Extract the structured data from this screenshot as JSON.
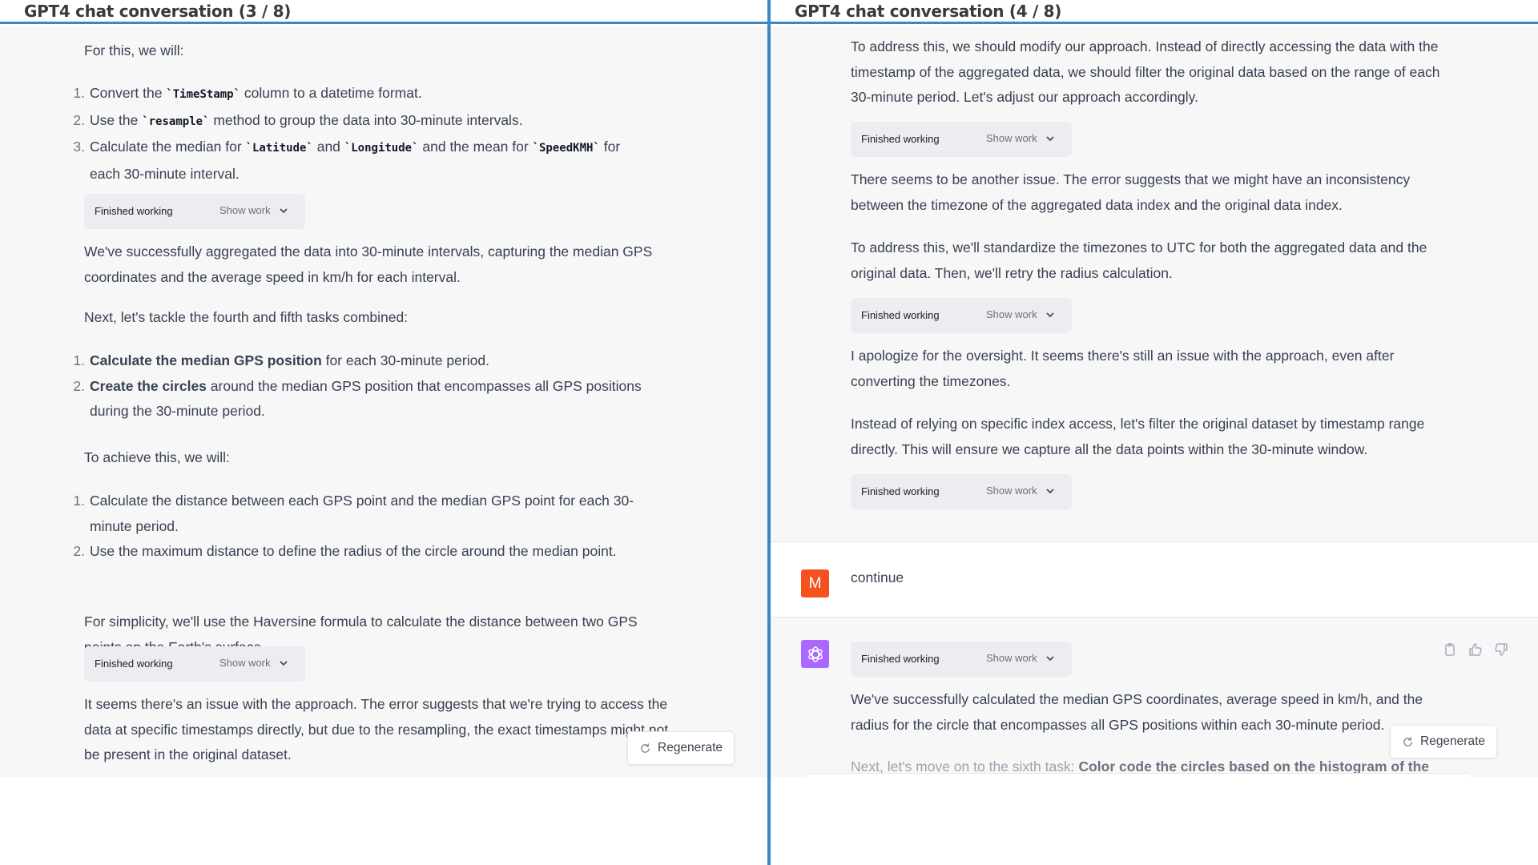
{
  "left_panel": {
    "title": "GPT4 chat conversation (3 / 8)",
    "intro": "For this, we will:",
    "list1": [
      {
        "num": "1.",
        "pre": "Convert the ",
        "code": "`TimeStamp`",
        "post": " column to a datetime format."
      },
      {
        "num": "2.",
        "pre": "Use the ",
        "code": "`resample`",
        "post": " method to group the data into 30-minute intervals."
      },
      {
        "num": "3.",
        "pre": "Calculate the median for ",
        "code1": "`Latitude`",
        "mid1": " and ",
        "code2": "`Longitude`",
        "mid2": " and the mean for ",
        "code3": "`SpeedKMH`",
        "post": " for each 30-minute interval."
      }
    ],
    "finished_working": "Finished working",
    "show_work": "Show work",
    "para_aggregated": "We've successfully aggregated the data into 30-minute intervals, capturing the median GPS coordinates and the average speed in km/h for each interval.",
    "para_next": "Next, let's tackle the fourth and fifth tasks combined:",
    "list2": [
      {
        "num": "1.",
        "bold": "Calculate the median GPS position",
        "rest": " for each 30-minute period."
      },
      {
        "num": "2.",
        "bold": "Create the circles",
        "rest": " around the median GPS position that encompasses all GPS positions during the 30-minute period."
      }
    ],
    "para_achieve": "To achieve this, we will:",
    "list3": [
      {
        "num": "1.",
        "text": "Calculate the distance between each GPS point and the median GPS point for each 30-minute period."
      },
      {
        "num": "2.",
        "text": "Use the maximum distance to define the radius of the circle around the median point."
      }
    ],
    "para_haversine": "For simplicity, we'll use the Haversine formula to calculate the distance between two GPS points on the Earth's surface.",
    "para_issue": "It seems there's an issue with the approach. The error suggests that we're trying to access the data at specific timestamps directly, but due to the resampling, the exact timestamps might not be present in the original dataset.",
    "regenerate": "Regenerate"
  },
  "right_panel": {
    "title": "GPT4 chat conversation (4 / 8)",
    "para_address": "To address this, we should modify our approach. Instead of directly accessing the data with the timestamp of the aggregated data, we should filter the original data based on the range of each 30-minute period. Let's adjust our approach accordingly.",
    "para_another": "There seems to be another issue. The error suggests that we might have an inconsistency between the timezone of the aggregated data index and the original data index.",
    "para_utc": "To address this, we'll standardize the timezones to UTC for both the aggregated data and the original data. Then, we'll retry the radius calculation.",
    "para_apologize": "I apologize for the oversight. It seems there's still an issue with the approach, even after converting the timezones.",
    "para_instead": "Instead of relying on specific index access, let's filter the original dataset by timestamp range directly. This will ensure we capture all the data points within the 30-minute window.",
    "finished_working": "Finished working",
    "show_work": "Show work",
    "user_avatar_letter": "M",
    "user_message": "continue",
    "para_success": "We've successfully calculated the median GPS coordinates, average speed in km/h, and the radius for the circle that encompasses all GPS positions within each 30-minute period.",
    "para_sixth_pre": "Next, let's move on to the sixth task: ",
    "para_sixth_bold": "Color code the circles based on the histogram of the",
    "regenerate": "Regenerate",
    "action_icons": [
      "copy-icon",
      "thumbs-up-icon",
      "thumbs-down-icon"
    ]
  },
  "colors": {
    "divider": "#3d85c6",
    "user_avatar": "#f4511e",
    "gpt_avatar": "#ab68ff",
    "assistant_bg": "#f7f7f8",
    "finished_box_bg": "#ececf1"
  }
}
